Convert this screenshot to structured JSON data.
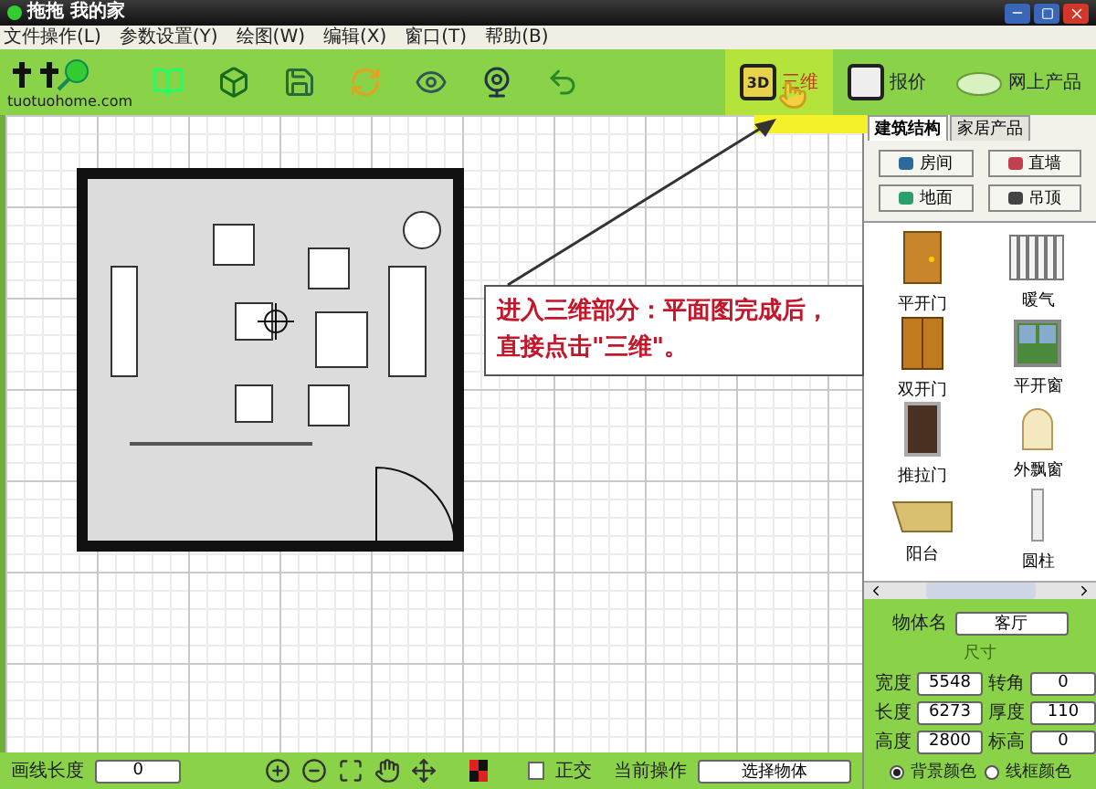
{
  "window": {
    "title": "拖拖 我的家"
  },
  "menu": [
    "文件操作(L)",
    "参数设置(Y)",
    "绘图(W)",
    "编辑(X)",
    "窗口(T)",
    "帮助(B)"
  ],
  "logo": {
    "text": "tuotuohome.com"
  },
  "toolbar_right": [
    {
      "icon_text": "3D",
      "label": "三维",
      "selected": true
    },
    {
      "label": "报价",
      "selected": false
    },
    {
      "label": "网上产品",
      "selected": false
    }
  ],
  "tabs": [
    {
      "label": "建筑结构",
      "selected": true
    },
    {
      "label": "家居产品",
      "selected": false
    }
  ],
  "structure_buttons": [
    "房间",
    "直墙",
    "地面",
    "吊顶"
  ],
  "items": [
    "平开门",
    "暖气",
    "双开门",
    "平开窗",
    "推拉门",
    "外飘窗",
    "阳台",
    "圆柱"
  ],
  "properties": {
    "name_label": "物体名",
    "name_value": "客厅",
    "group_label": "尺寸",
    "fields": [
      {
        "label": "宽度",
        "value": "5548"
      },
      {
        "label": "转角",
        "value": "0"
      },
      {
        "label": "长度",
        "value": "6273"
      },
      {
        "label": "厚度",
        "value": "110"
      },
      {
        "label": "高度",
        "value": "2800"
      },
      {
        "label": "标高",
        "value": "0"
      }
    ]
  },
  "color_options": [
    {
      "label": "背景颜色",
      "selected": true
    },
    {
      "label": "线框颜色",
      "selected": false
    }
  ],
  "callout": {
    "text": "进入三维部分：平面图完成后，直接点击\"三维\"。"
  },
  "status_bar": {
    "line_length_label": "画线长度",
    "line_length_value": "0",
    "ortho": {
      "label": "正交",
      "checked": false
    },
    "operation_label": "当前操作",
    "operation_value": "选择物体"
  }
}
